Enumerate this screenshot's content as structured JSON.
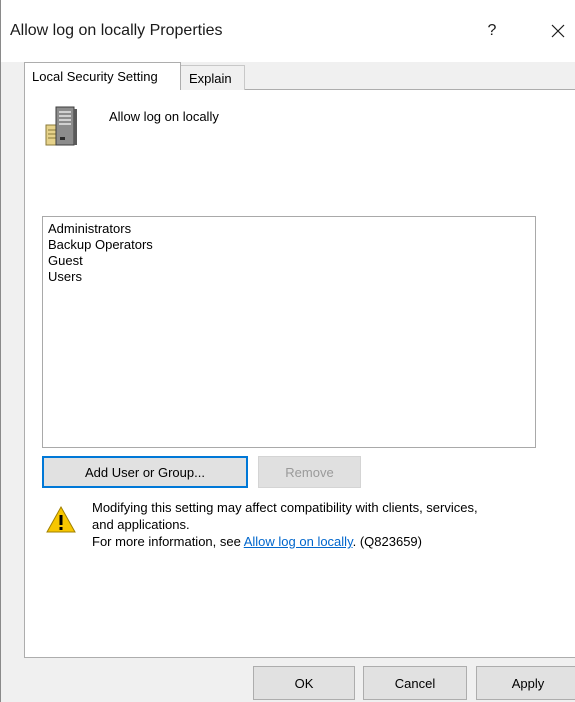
{
  "window": {
    "title": "Allow log on locally Properties",
    "help_label": "?"
  },
  "tabs": [
    {
      "label": "Local Security Setting",
      "active": true
    },
    {
      "label": "Explain",
      "active": false
    }
  ],
  "policy": {
    "name": "Allow log on locally",
    "icon": "server-tower-icon"
  },
  "members": [
    "Administrators",
    "Backup Operators",
    "Guest",
    "Users"
  ],
  "buttons": {
    "add_label": "Add User or Group...",
    "remove_label": "Remove",
    "ok_label": "OK",
    "cancel_label": "Cancel",
    "apply_label": "Apply"
  },
  "warning": {
    "icon": "warning-triangle-icon",
    "line1": "Modifying this setting may affect compatibility with clients, services,",
    "line2": "and applications.",
    "line3_prefix": "For more information, see ",
    "link_text": "Allow log on locally",
    "line3_suffix": ". (Q823659)"
  },
  "colors": {
    "accent": "#0078d7",
    "link": "#0066cc",
    "dialog_bg": "#f0f0f0",
    "warning_yellow": "#f7c600"
  }
}
